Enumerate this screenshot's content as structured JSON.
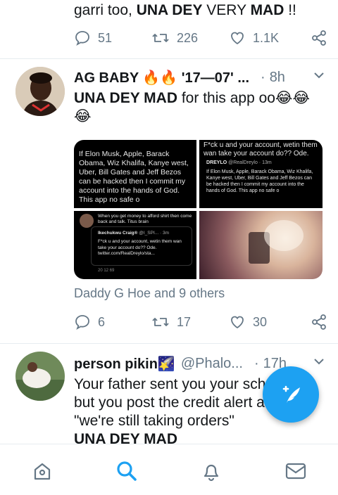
{
  "previous_tweet": {
    "text_start": "garri too, ",
    "text_bold1": "UNA DEY",
    "text_mid": " VERY ",
    "text_bold2": "MAD",
    "text_end": " !!",
    "reply_count": "51",
    "retweet_count": "226",
    "like_count": "1.1K"
  },
  "tweet1": {
    "name": "AG BABY 🔥🔥 '17—07' ...",
    "dot": "·",
    "time": "8h",
    "text_bold": "UNA DEY MAD",
    "text_rest": " for this app oo😂😂",
    "text_line2": "😂",
    "media": {
      "cell1_text": "If Elon Musk, Apple, Barack Obama, Wiz Khalifa, Kanye west, Uber, Bill Gates and Jeff Bezos can be hacked then I commit my account into the hands of God. This app no safe o",
      "cell2_top": "F*ck u and your account, wetin them wan take your account do?? Ode.",
      "cell2_user_name": "DREYLO",
      "cell2_user_handle": "@RealDreylo · 13m",
      "cell2_text": "If Elon Musk, Apple, Barack Obama, Wiz Khalifa, Kanye west, Uber, Bill Gates and Jeff Bezos can be hacked then I commit my account into the hands of God. This app no safe o",
      "cell3_top": "When you get money to afford shirt then come back and talk. Titus brain",
      "cell3_user_name": "Ikechukwu Craig®",
      "cell3_user_handle": "@I_SPI... · 3m",
      "cell3_text": "F*ck u and your account, wetin them wan take your account do?? Ode. twitter.com/RealDreylo/sta...",
      "cell3_stats": "20     12     69"
    },
    "liked_by": "Daddy G Hoe and 9 others",
    "reply_count": "6",
    "retweet_count": "17",
    "like_count": "30"
  },
  "tweet2": {
    "name": "person pikin🌠",
    "handle": "@Phalo...",
    "dot": "·",
    "time": "17h",
    "line1": "Your father sent you your sch",
    "line2": "but you post the credit alert a",
    "line3": "\"we're still taking orders\"",
    "line4": "UNA DEY MAD"
  },
  "nav": {
    "items": [
      "home-icon",
      "search-icon",
      "notifications-icon",
      "messages-icon"
    ],
    "active": "search-icon"
  },
  "colors": {
    "accent": "#1da1f2",
    "secondary_text": "#657786",
    "divider": "#e6ecf0"
  }
}
